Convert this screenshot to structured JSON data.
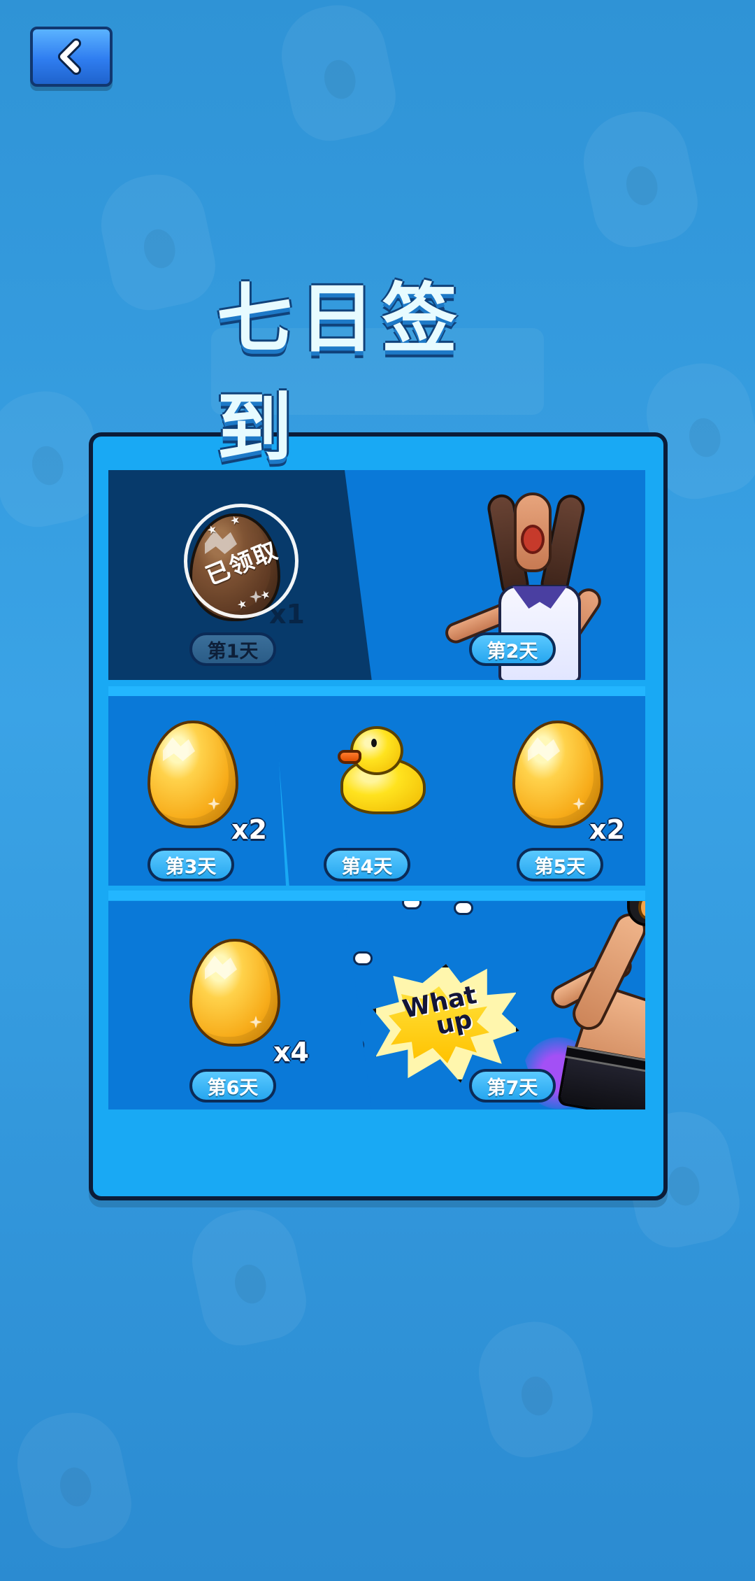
{
  "screen": {
    "title": "七日签到",
    "back_icon": "chevron-left-icon",
    "days": [
      {
        "label": "第1天",
        "reward_type": "egg",
        "quantity": "x1",
        "status": "已领取",
        "claimed": true
      },
      {
        "label": "第2天",
        "reward_type": "character",
        "quantity": "",
        "status": "",
        "claimed": false
      },
      {
        "label": "第3天",
        "reward_type": "egg",
        "quantity": "x2",
        "status": "",
        "claimed": false
      },
      {
        "label": "第4天",
        "reward_type": "duck",
        "quantity": "",
        "status": "",
        "claimed": false
      },
      {
        "label": "第5天",
        "reward_type": "egg",
        "quantity": "x2",
        "status": "",
        "claimed": false
      },
      {
        "label": "第6天",
        "reward_type": "egg",
        "quantity": "x4",
        "status": "",
        "claimed": false
      },
      {
        "label": "第7天",
        "reward_type": "character",
        "quantity": "",
        "status": "",
        "claimed": false
      }
    ],
    "day7_burst_text_1": "What",
    "day7_burst_text_2": "up"
  }
}
